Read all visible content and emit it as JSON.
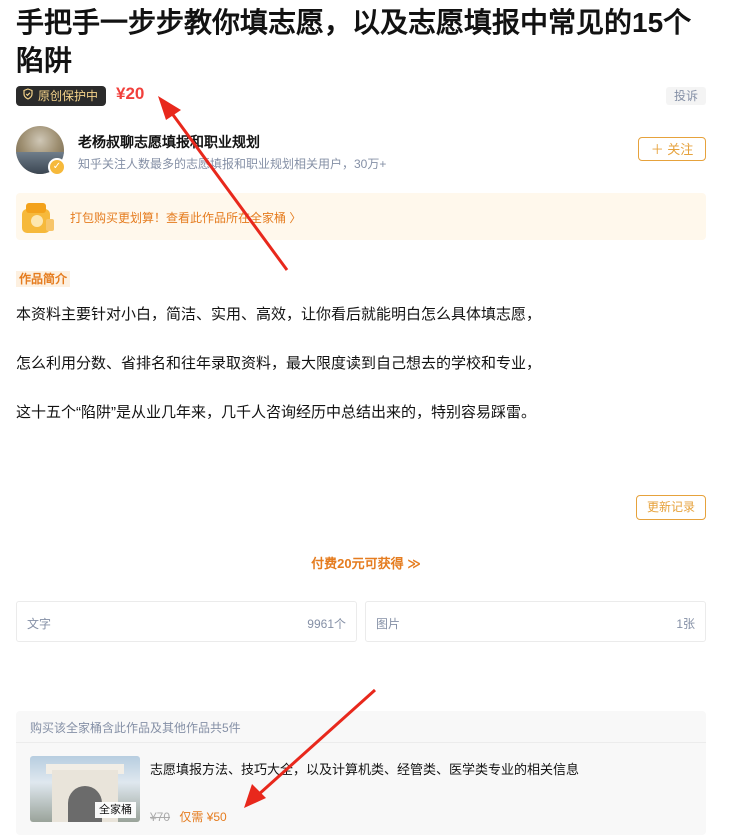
{
  "article": {
    "title": "手把手一步步教你填志愿，以及志愿填报中常见的15个陷阱",
    "badge_label": "原创保护中",
    "price": "¥20",
    "report_label": "投诉"
  },
  "author": {
    "name": "老杨叔聊志愿填报和职业规划",
    "description": "知乎关注人数最多的志愿填报和职业规划相关用户，30万+",
    "follow_label": "＋ 关注"
  },
  "promo": {
    "text": "打包购买更划算！查看此作品所在全家桶 〉"
  },
  "intro": {
    "tag": "作品简介",
    "paragraphs": [
      "本资料主要针对小白，简洁、实用、高效，让你看后就能明白怎么具体填志愿，",
      "怎么利用分数、省排名和往年录取资料，最大限度读到自己想去的学校和专业，",
      "这十五个“陷阱”是从业几年来，几千人咨询经历中总结出来的，特别容易踩雷。"
    ]
  },
  "update_label": "更新记录",
  "pay_label": "付费20元可获得 ≫",
  "stats": {
    "text_label": "文字",
    "text_count": "9961个",
    "image_label": "图片",
    "image_count": "1张"
  },
  "bundle": {
    "header": "购买该全家桶含此作品及其他作品共5件",
    "thumb_tag": "全家桶",
    "title": "志愿填报方法、技巧大全，以及计算机类、经管类、医学类专业的相关信息",
    "old_price": "¥70",
    "new_price": "仅需 ¥50"
  },
  "colors": {
    "accent": "#e57c1f",
    "price_red": "#f1403c",
    "annotation_arrow": "#e8281c"
  },
  "icons": [
    "shield-icon",
    "verified-icon",
    "gift-bag-icon",
    "chevron-down-icon"
  ]
}
